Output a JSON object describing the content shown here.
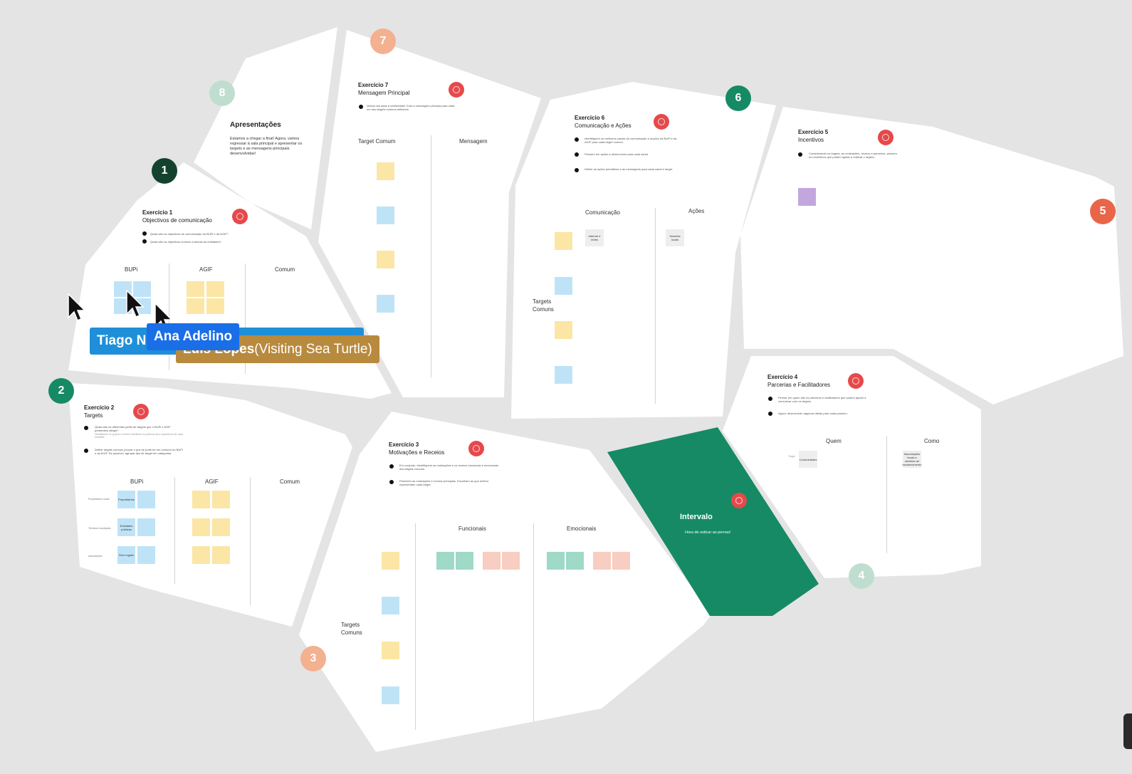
{
  "colors": {
    "canvas": "#e4e4e4",
    "region": "#ffffff",
    "intervalo": "#168a64",
    "timer": "#e6494b",
    "sticky_blue": "#bfe3f6",
    "sticky_yellow": "#fbe6a6",
    "sticky_teal": "#9fd9c7",
    "sticky_pink": "#f8cdc2",
    "sticky_purple": "#c2a7df",
    "sticky_grey": "#eeeeee"
  },
  "badges": {
    "b1": "1",
    "b2": "2",
    "b3": "3",
    "b4": "4",
    "b5": "5",
    "b6": "6",
    "b7": "7",
    "b8": "8"
  },
  "apresentacoes": {
    "title": "Apresentações",
    "body": "Estamos a chegar a final! Agora, vamos regressar à sala principal e apresentar os targets e as mensagens principais desenvolvidas!"
  },
  "ex1": {
    "number": "Exercício 1",
    "title": "Objectivos de comunicação",
    "q1": "Quais são os objectivos de comunicação do BUPi e da AGIF?",
    "q2": "Quais são os objectivos comuns a ambas as entidades?",
    "cols": [
      "BUPi",
      "AGIF",
      "Comum"
    ]
  },
  "ex2": {
    "number": "Exercício 2",
    "title": "Targets",
    "q1": "Quais são os diferentes perfis de targets que o BUPi e AGIF pretendem atingir?",
    "q1_note": "Identifiquem os grupos e tentem identificar os públicos-alvo específicos de cada entidade.",
    "q2": "Definir targets comuns (cruzar o que se pode ter em comum) do BUPi e da AGIF. Se possível, agrupar tipo de target em categorias.",
    "cols": [
      "BUPi",
      "AGIF",
      "Comum"
    ],
    "rows": [
      "Proprietários rurais",
      "Técnicos municipais",
      "Associações"
    ],
    "notes": [
      "Proprietários",
      "Entidades públicas",
      "Sem registo"
    ]
  },
  "ex3": {
    "number": "Exercício 3",
    "title": "Motivações e Receios",
    "q1": "Em conjunto, identifiquem as motivações e os receios funcionais e emocionais dos targets comuns.",
    "q2": "Priorizem as motivações e receios principais. Escolham as que melhor representam cada target.",
    "cols": [
      "Funcionais",
      "Emocionais"
    ],
    "row_label": "Targets Comuns"
  },
  "ex4": {
    "number": "Exercício 4",
    "title": "Parcerias e Facilitadores",
    "q1": "Pensar em quem são os parceiros e facilitadores que podem ajudar a comunicar com os targets.",
    "q2": "Agora, desenvolver algumas ideias para cada parceiro.",
    "cols": [
      "Quem",
      "Como"
    ],
    "row_label": "Target",
    "note_quem": "Comunidades",
    "note_como": "Associações locais e sessões de esclarecimento"
  },
  "ex5": {
    "number": "Exercício 5",
    "title": "Incentivos",
    "q1": "Considerando os targets, as motivações, receios e parceiros, pensem em incentivos que podem ajudar a realizar o registo."
  },
  "ex6": {
    "number": "Exercício 6",
    "title": "Comunicação e Ações",
    "q1": "Identifiquem os melhores canais de comunicação e acções do BUPi e da AGIF para cada target comum.",
    "q2": "Pensem em ações a desenvolver para cada canal.",
    "q3": "Definir as ações prioritárias e as mensagens para cada canal e target.",
    "cols": [
      "Comunicação",
      "Ações"
    ],
    "row_label": "Targets Comuns",
    "note_com": "Internet e redes",
    "note_acoes": "Sessões locais"
  },
  "ex7": {
    "number": "Exercício 7",
    "title": "Mensagem Principal",
    "q1": "Vamos dar asas à criatividade! Criar a mensagem principal para cada um dos targets comuns definidos.",
    "cols": [
      "Target Comum",
      "Mensagem"
    ]
  },
  "intervalo": {
    "title": "Intervalo",
    "subtitle": "Hora de esticar as pernas!"
  },
  "collaborators": {
    "tiago": "Tiago N",
    "ana": "Ana Adelino",
    "luis_name": "Luís Lopes",
    "luis_suffix": " (Visiting Sea Turtle)",
    "tiago_color": "#1e8fd8",
    "ana_color": "#1a6ee8",
    "luis_color": "#b88a3e"
  }
}
